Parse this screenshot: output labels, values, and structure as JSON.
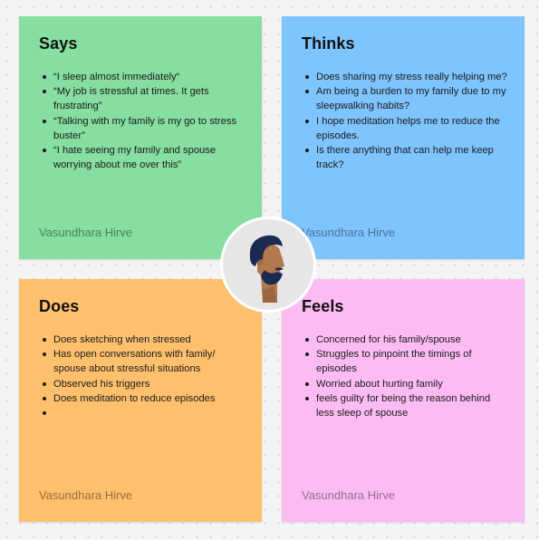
{
  "notes": {
    "says": {
      "title": "Says",
      "items": [
        "“I sleep almost immediately“",
        "“My job is stressful at times. It gets frustrating”",
        "“Talking with my family is my go to stress buster”",
        "“I hate seeing my family and spouse worrying about me over this”"
      ],
      "author": "Vasundhara Hirve",
      "color": "#86dea0"
    },
    "thinks": {
      "title": "Thinks",
      "items": [
        "Does sharing my stress really helping me?",
        "Am being a burden to my family due to my sleepwalking habits?",
        "I hope meditation helps me to reduce the episodes.",
        "Is there anything that can help me keep track?"
      ],
      "author": "Vasundhara Hirve",
      "color": "#7ec4ff"
    },
    "does": {
      "title": "Does",
      "items": [
        "Does sketching when stressed",
        "Has open conversations with family/ spouse about stressful situations",
        "Observed his triggers",
        "Does meditation to reduce episodes",
        ""
      ],
      "author": "Vasundhara Hirve",
      "color": "#ffc06e"
    },
    "feels": {
      "title": "Feels",
      "items": [
        "Concerned for his family/spouse",
        "Struggles to pinpoint the timings of episodes",
        "Worried about hurting family",
        "feels guilty for being the reason behind less sleep of spouse"
      ],
      "author": "Vasundhara Hirve",
      "color": "#fcbcf3"
    }
  },
  "persona": {
    "icon": "user-avatar-icon",
    "hair_color": "#1c2a52",
    "skin_color": "#b2794c",
    "background": "#e6e6e6"
  }
}
